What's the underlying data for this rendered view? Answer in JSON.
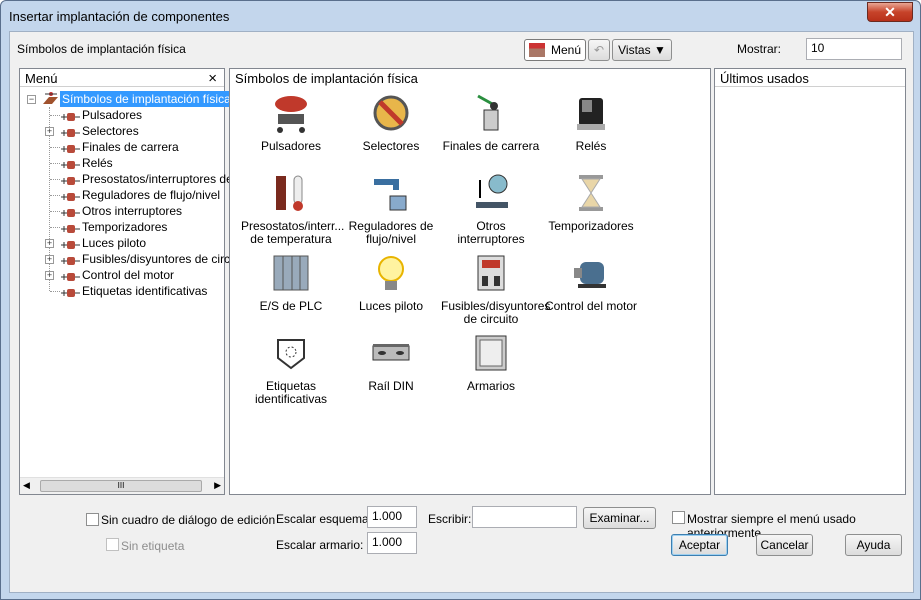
{
  "window": {
    "title": "Insertar implantación de componentes",
    "close": "✕"
  },
  "toolbar": {
    "section_label": "Símbolos de implantación física",
    "menu_button": "Menú",
    "views_button": "Vistas",
    "show_label": "Mostrar:",
    "show_value": "10"
  },
  "menu_panel": {
    "title": "Menú",
    "close": "×",
    "root": "Símbolos de implantación física",
    "items": [
      {
        "label": "Pulsadores",
        "expandable": false
      },
      {
        "label": "Selectores",
        "expandable": true
      },
      {
        "label": "Finales de carrera",
        "expandable": false
      },
      {
        "label": "Relés",
        "expandable": false
      },
      {
        "label": "Presostatos/interruptores de te",
        "expandable": false
      },
      {
        "label": "Reguladores de flujo/nivel",
        "expandable": false
      },
      {
        "label": "Otros interruptores",
        "expandable": false
      },
      {
        "label": "Temporizadores",
        "expandable": false
      },
      {
        "label": "Luces piloto",
        "expandable": true
      },
      {
        "label": "Fusibles/disyuntores de circuit",
        "expandable": true
      },
      {
        "label": "Control del motor",
        "expandable": true
      },
      {
        "label": "Etiquetas identificativas",
        "expandable": false
      }
    ],
    "scroll_thumb": "III"
  },
  "symbols_panel": {
    "title": "Símbolos de implantación física",
    "items": [
      {
        "l1": "Pulsadores",
        "l2": "",
        "icon": "pushbutton-icon"
      },
      {
        "l1": "Selectores",
        "l2": "",
        "icon": "selector-icon"
      },
      {
        "l1": "Finales de carrera",
        "l2": "",
        "icon": "limit-switch-icon"
      },
      {
        "l1": "Relés",
        "l2": "",
        "icon": "relay-icon"
      },
      {
        "l1": "Presostatos/interr...",
        "l2": "de temperatura",
        "icon": "thermometer-icon"
      },
      {
        "l1": "Reguladores de",
        "l2": "flujo/nivel",
        "icon": "faucet-icon"
      },
      {
        "l1": "Otros interruptores",
        "l2": "",
        "icon": "scale-icon"
      },
      {
        "l1": "Temporizadores",
        "l2": "",
        "icon": "hourglass-icon"
      },
      {
        "l1": "E/S de PLC",
        "l2": "",
        "icon": "plc-icon"
      },
      {
        "l1": "Luces piloto",
        "l2": "",
        "icon": "lightbulb-icon"
      },
      {
        "l1": "Fusibles/disyuntores",
        "l2": "de circuito",
        "icon": "fuse-icon"
      },
      {
        "l1": "Control del motor",
        "l2": "",
        "icon": "motor-icon"
      },
      {
        "l1": "Etiquetas",
        "l2": "identificativas",
        "icon": "tag-icon"
      },
      {
        "l1": "Raíl DIN",
        "l2": "",
        "icon": "din-rail-icon"
      },
      {
        "l1": "Armarios",
        "l2": "",
        "icon": "cabinet-icon"
      }
    ]
  },
  "recent_panel": {
    "title": "Últimos usados"
  },
  "footer": {
    "no_edit_dialog": "Sin cuadro de diálogo de edición",
    "no_tag": "Sin etiqueta",
    "scale_schematic_label": "Escalar esquema:",
    "scale_schematic": "1.000",
    "scale_cabinet_label": "Escalar armario:",
    "scale_cabinet": "1.000",
    "write_label": "Escribir:",
    "write_value": "",
    "browse": "Examinar...",
    "always_show_menu": "Mostrar siempre el menú usado anteriormente",
    "accept": "Aceptar",
    "cancel": "Cancelar",
    "help": "Ayuda"
  }
}
